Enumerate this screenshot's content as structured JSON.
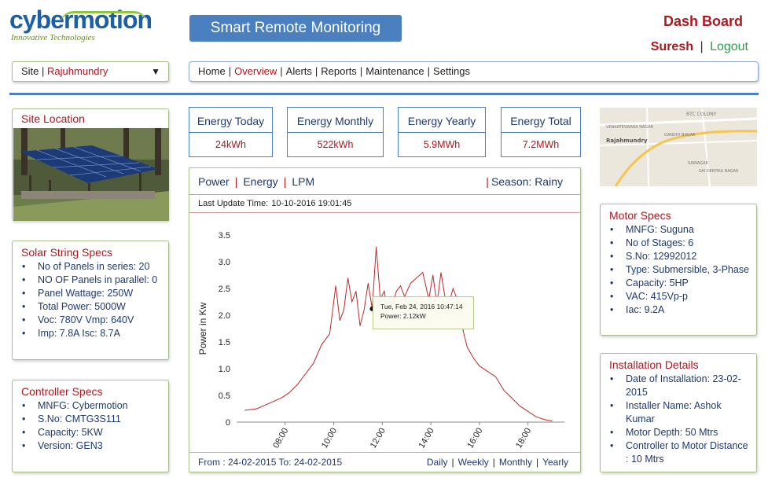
{
  "logo": {
    "brand": "cybermotion",
    "tagline": "Innovative Technologies"
  },
  "app_title": "Smart Remote Monitoring",
  "dashboard_title": "Dash Board",
  "user": {
    "name": "Suresh",
    "separator": "|",
    "logout": "Logout"
  },
  "site": {
    "label": "Site",
    "separator": "|",
    "value": "Rajuhmundry"
  },
  "nav": {
    "items": [
      "Home",
      "Overview",
      "Alerts",
      "Reports",
      "Maintenance",
      "Settings"
    ],
    "active": "Overview"
  },
  "site_location": {
    "title": "Site Location"
  },
  "solar_specs": {
    "title": "Solar String Specs",
    "items": [
      "No of Panels in series: 20",
      "NO OF Panels in parallel: 0",
      "Panel Wattage: 250W",
      "Total Power: 5000W",
      "Voc: 780V Vmp: 640V",
      "Imp: 7.8A  Isc: 8.7A"
    ]
  },
  "controller_specs": {
    "title": "Controller Specs",
    "items": [
      "MNFG: Cybermotion",
      "S.No: CMTG3S111",
      "Capacity: 5KW",
      "Version: GEN3"
    ]
  },
  "motor_specs": {
    "title": "Motor Specs",
    "items": [
      "MNFG: Suguna",
      "No of Stages: 6",
      "S.No: 12992012",
      "Type: Submersible, 3-Phase",
      "Capacity: 5HP",
      "VAC: 415Vp-p",
      "Iac: 9.2A"
    ]
  },
  "installation": {
    "title": "Installation Details",
    "items": [
      "Date of Installation: 23-02-2015",
      "Installer Name: Ashok Kumar",
      "Motor Depth: 50 Mtrs",
      "Controller to Motor Distance : 10 Mtrs"
    ]
  },
  "map": {
    "labels": [
      "BTC COLONY",
      "Rajahmundry",
      "SAINAGAR",
      "SAI DEEPIKA NAGAR",
      "GANDHI NAGAR",
      "VENKATESWARA NAGAR"
    ]
  },
  "energy": [
    {
      "label": "Energy Today",
      "value": "24kWh"
    },
    {
      "label": "Energy Monthly",
      "value": "522kWh"
    },
    {
      "label": "Energy Yearly",
      "value": "5.9MWh"
    },
    {
      "label": "Energy Total",
      "value": "7.2MWh"
    }
  ],
  "chart_tabs": [
    "Power",
    "Energy",
    "LPM"
  ],
  "season": "Season: Rainy",
  "last_update": {
    "label": "Last Update Time:",
    "value": "10-10-2016 19:01:45"
  },
  "tooltip": {
    "line1": "Tue, Feb 24, 2016 10:47:14",
    "line2": "Power: 2.12kW"
  },
  "footer": {
    "range": "From : 24-02-2015 To: 24-02-2015",
    "options": [
      "Daily",
      "Weekly",
      "Monthly",
      "Yearly"
    ]
  },
  "colors": {
    "accent": "#4a7fc0",
    "brand_red": "#b0171f",
    "line": "#c0282a",
    "green": "#2aa04a"
  },
  "chart_data": {
    "type": "line",
    "title": "",
    "xlabel": "",
    "ylabel": "Power in Kw",
    "ylim": [
      0,
      3.5
    ],
    "xlim": [
      "06:00",
      "19:30"
    ],
    "yticks": [
      "0",
      "0.5",
      "1.0",
      "1.5",
      "2.0",
      "2.5",
      "3.0",
      "3.5"
    ],
    "xticks": [
      "08:00",
      "10:00",
      "12:00",
      "14:00",
      "16:00",
      "18:00"
    ],
    "series": [
      {
        "x": [
          "06:20",
          "06:50",
          "07:20",
          "07:50",
          "08:10",
          "08:30",
          "08:50",
          "09:10",
          "09:30",
          "09:50",
          "10:05",
          "10:15",
          "10:25",
          "10:35",
          "10:45",
          "10:55",
          "11:05",
          "11:15",
          "11:25",
          "11:35",
          "11:45",
          "11:55",
          "12:05",
          "12:15",
          "12:25",
          "12:35",
          "12:45",
          "12:55",
          "13:10",
          "13:25",
          "13:40",
          "13:55",
          "14:05",
          "14:15",
          "14:25",
          "14:40",
          "14:55",
          "15:10",
          "15:20",
          "15:30",
          "15:45",
          "16:00",
          "16:20",
          "16:40",
          "17:00",
          "17:20",
          "17:40",
          "18:00",
          "18:20",
          "18:40",
          "19:00"
        ],
        "values": [
          0.22,
          0.25,
          0.35,
          0.45,
          0.55,
          0.7,
          0.9,
          1.1,
          1.45,
          1.65,
          2.55,
          1.9,
          2.1,
          2.7,
          2.25,
          2.45,
          1.8,
          2.1,
          2.6,
          2.12,
          3.28,
          2.3,
          2.45,
          2.0,
          2.2,
          2.45,
          2.55,
          2.35,
          2.6,
          2.7,
          2.8,
          2.3,
          2.75,
          2.2,
          2.8,
          2.1,
          2.5,
          2.2,
          1.7,
          1.4,
          1.2,
          1.05,
          0.95,
          0.85,
          0.6,
          0.45,
          0.3,
          0.2,
          0.1,
          0.05,
          0.02
        ]
      }
    ]
  }
}
